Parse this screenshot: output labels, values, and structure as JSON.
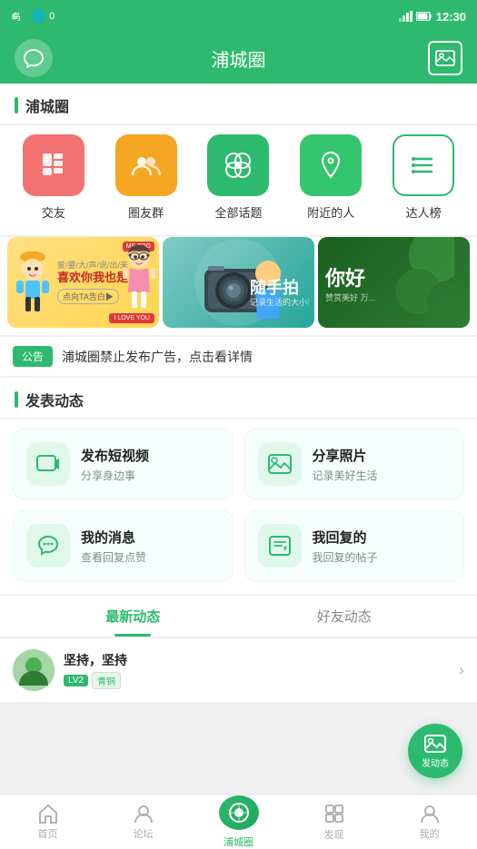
{
  "statusBar": {
    "time": "12:30",
    "leftIcon": "phone-icon",
    "signal": "📶"
  },
  "header": {
    "title": "浦城圈",
    "leftIcon": "chat-icon",
    "rightIcon": "image-icon"
  },
  "sectionTitle": "浦城圈",
  "icons": [
    {
      "label": "交友",
      "color": "red",
      "icon": "📚"
    },
    {
      "label": "圈友群",
      "color": "orange",
      "icon": "👥"
    },
    {
      "label": "全部话题",
      "color": "teal",
      "icon": "💬"
    },
    {
      "label": "附近的人",
      "color": "green-dark",
      "icon": "📍"
    },
    {
      "label": "达人榜",
      "color": "outlined",
      "icon": "☰"
    }
  ],
  "banners": [
    {
      "id": "banner1",
      "mainText": "喜欢你我也是",
      "subText": "爱/要/大/声/说/出/来",
      "cta": "点击向TA告白>",
      "loveBadge": "I LOVE YOU",
      "bg": "yellow"
    },
    {
      "id": "banner2",
      "mainText": "随手拍",
      "subText": "记录生活的大小事",
      "bg": "green"
    },
    {
      "id": "banner3",
      "mainText": "你好",
      "subText": "赞赏美好 万...",
      "bg": "dark"
    }
  ],
  "notice": {
    "tag": "公告",
    "text": "浦城圈禁止发布广告，点击看详情"
  },
  "postSection": {
    "title": "发表动态",
    "actions": [
      {
        "id": "video",
        "title": "发布短视频",
        "sub": "分享身边事",
        "icon": "📷"
      },
      {
        "id": "photo",
        "title": "分享照片",
        "sub": "记录美好生活",
        "icon": "🖼️"
      },
      {
        "id": "message",
        "title": "我的消息",
        "sub": "查看回复点赞",
        "icon": "🔔"
      },
      {
        "id": "reply",
        "title": "我回复的",
        "sub": "我回复的帖子",
        "icon": "✏️"
      }
    ]
  },
  "tabs": [
    {
      "id": "latest",
      "label": "最新动态",
      "active": true
    },
    {
      "id": "friends",
      "label": "好友动态",
      "active": false
    }
  ],
  "userPost": {
    "name": "坚持，坚持",
    "levelBadge": "LV2",
    "titleBadge": "青铜",
    "avatar": "🌿"
  },
  "fab": {
    "icon": "🖼️",
    "label": "发动态"
  },
  "bottomNav": [
    {
      "id": "home",
      "label": "首页",
      "icon": "⌂",
      "active": false
    },
    {
      "id": "forum",
      "label": "论坛",
      "icon": "👤",
      "active": false
    },
    {
      "id": "circle",
      "label": "浦城圈",
      "icon": "◈",
      "active": true
    },
    {
      "id": "discover",
      "label": "发现",
      "icon": "◇",
      "active": false
    },
    {
      "id": "mine",
      "label": "我的",
      "icon": "👤",
      "active": false
    }
  ]
}
